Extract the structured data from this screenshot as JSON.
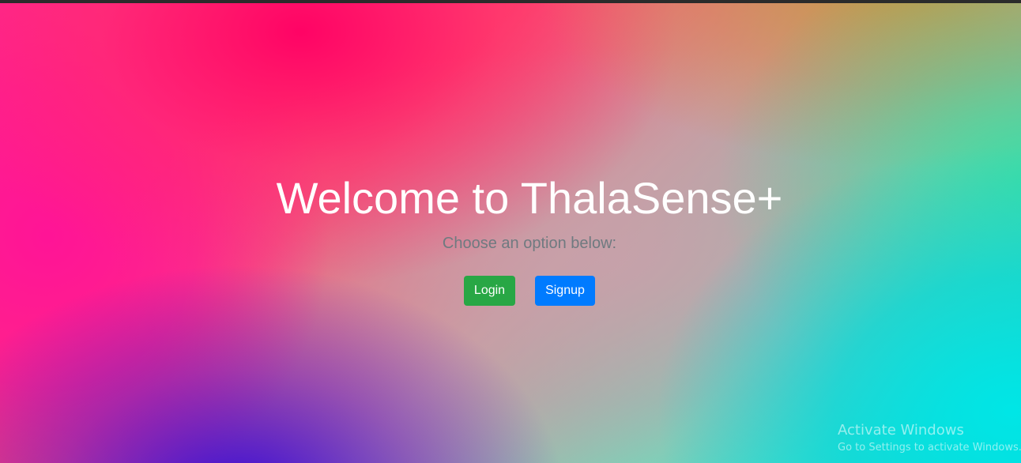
{
  "page": {
    "title": "Welcome to ThalaSense+",
    "subtitle": "Choose an option below:"
  },
  "actions": {
    "login_label": "Login",
    "signup_label": "Signup"
  },
  "colors": {
    "login_button": "#28a745",
    "signup_button": "#007bff",
    "title_text": "#ffffff",
    "subtitle_text": "#6f7a80"
  },
  "os_watermark": {
    "title": "Activate Windows",
    "subtitle": "Go to Settings to activate Windows."
  }
}
